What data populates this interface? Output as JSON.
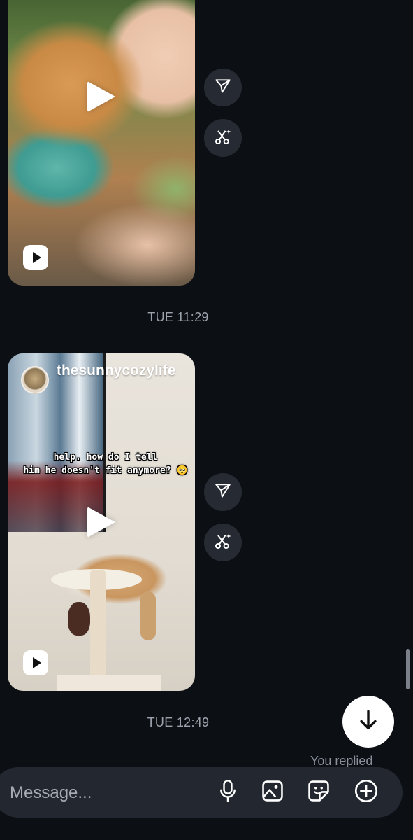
{
  "thread": {
    "messages": [
      {
        "type": "reel",
        "username": "",
        "caption": "",
        "actions": {
          "share_icon": "paper-plane-icon",
          "remix_icon": "scissors-sparkle-icon"
        }
      },
      {
        "type": "timestamp",
        "text": "TUE 11:29"
      },
      {
        "type": "reel",
        "username": "thesunnycozylife",
        "caption_lines": [
          "help. how do I tell",
          "him he doesn't fit anymore? 🥺"
        ],
        "actions": {
          "share_icon": "paper-plane-icon",
          "remix_icon": "scissors-sparkle-icon"
        }
      },
      {
        "type": "timestamp",
        "text": "TUE 12:49"
      }
    ],
    "status": {
      "replied_label": "You replied"
    }
  },
  "composer": {
    "placeholder": "Message...",
    "tools": [
      "microphone-icon",
      "image-icon",
      "sticker-icon",
      "plus-circle-icon"
    ]
  },
  "colors": {
    "background": "#0c0f14",
    "composer_bg": "#232830",
    "timestamp_text": "#9da3ad",
    "side_button_bg": "#262b33"
  }
}
